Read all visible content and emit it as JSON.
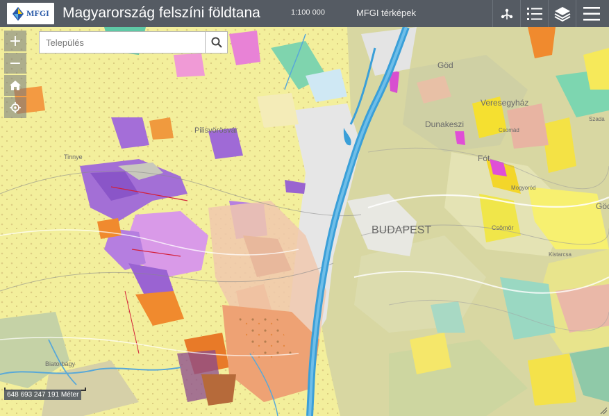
{
  "header": {
    "logo_text": "MFGI",
    "title": "Magyarország felszíni földtana",
    "scale": "1:100 000",
    "maps_link": "MFGI térképek"
  },
  "toolbar": {
    "items": [
      {
        "name": "share-icon",
        "label": ""
      },
      {
        "name": "legend-list-icon",
        "label": ""
      },
      {
        "name": "layers-icon",
        "label": ""
      },
      {
        "name": "menu-icon",
        "label": ""
      }
    ]
  },
  "search": {
    "placeholder": "Település",
    "value": ""
  },
  "map_controls": {
    "zoom_in": "+",
    "zoom_out": "−"
  },
  "map_labels": {
    "city": "BUDAPEST",
    "places": [
      "Dunakeszi",
      "Veresegyház",
      "Fót",
      "Göd",
      "Csömör",
      "Mogyoród",
      "Kistarcsa",
      "Csomád",
      "Pilisvörösvár",
      "Tinnye",
      "Biatorbágy",
      "Szada",
      "Gödöllő"
    ]
  },
  "coordinates_readout": "648 693 247 191 Méter",
  "colors": {
    "header_bg": "#555b63",
    "river": "#3a9fd8",
    "urban": "#e6e6e6",
    "loess_yellow": "#f2ee9a",
    "sand_olive": "#d9d8a0",
    "limestone_purple": "#a36fd6",
    "volcanic_orange": "#f08a2e",
    "accent_pink": "#e04fd6"
  }
}
